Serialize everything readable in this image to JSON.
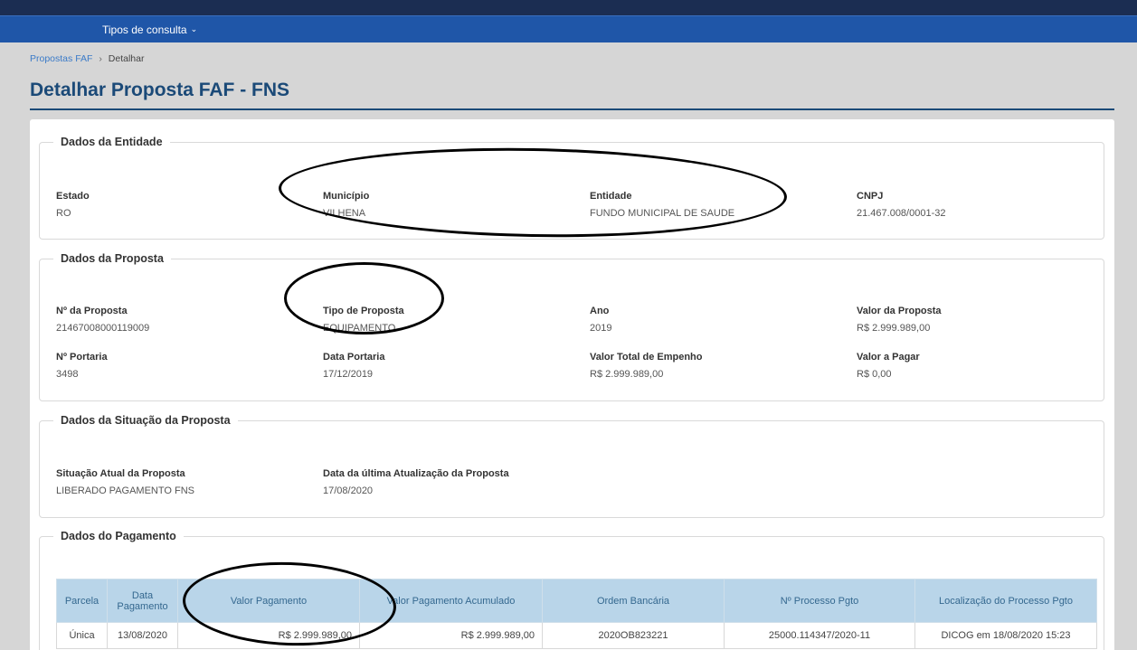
{
  "nav": {
    "tipos_consulta": "Tipos de consulta"
  },
  "breadcrumb": {
    "link": "Propostas FAF",
    "separator": "›",
    "current": "Detalhar"
  },
  "page_title": "Detalhar Proposta FAF - FNS",
  "entidade": {
    "legend": "Dados da Entidade",
    "estado_label": "Estado",
    "estado": "RO",
    "municipio_label": "Município",
    "municipio": "VILHENA",
    "entidade_label": "Entidade",
    "entidade": "FUNDO MUNICIPAL DE SAUDE",
    "cnpj_label": "CNPJ",
    "cnpj": "21.467.008/0001-32"
  },
  "proposta": {
    "legend": "Dados da Proposta",
    "numero_label": "Nº da Proposta",
    "numero": "21467008000119009",
    "tipo_label": "Tipo de Proposta",
    "tipo": "EQUIPAMENTO",
    "ano_label": "Ano",
    "ano": "2019",
    "valor_label": "Valor da Proposta",
    "valor": "R$ 2.999.989,00",
    "portaria_label": "Nº Portaria",
    "portaria": "3498",
    "data_portaria_label": "Data Portaria",
    "data_portaria": "17/12/2019",
    "empenho_label": "Valor Total de Empenho",
    "empenho": "R$ 2.999.989,00",
    "a_pagar_label": "Valor a Pagar",
    "a_pagar": "R$ 0,00"
  },
  "situacao": {
    "legend": "Dados da Situação da Proposta",
    "atual_label": "Situação Atual da Proposta",
    "atual": "LIBERADO PAGAMENTO FNS",
    "atualizacao_label": "Data da última Atualização da Proposta",
    "atualizacao": "17/08/2020"
  },
  "pagamento": {
    "legend": "Dados do Pagamento",
    "headers": {
      "parcela": "Parcela",
      "data_l1": "Data",
      "data_l2": "Pagamento",
      "valor": "Valor Pagamento",
      "acumulado": "Valor Pagamento Acumulado",
      "ordem": "Ordem Bancária",
      "processo": "Nº Processo Pgto",
      "localizacao": "Localização do Processo Pgto"
    },
    "row": {
      "parcela": "Única",
      "data": "13/08/2020",
      "valor": "R$ 2.999.989,00",
      "acumulado": "R$ 2.999.989,00",
      "ordem": "2020OB823221",
      "processo": "25000.114347/2020-11",
      "localizacao": "DICOG em 18/08/2020 15:23"
    }
  }
}
